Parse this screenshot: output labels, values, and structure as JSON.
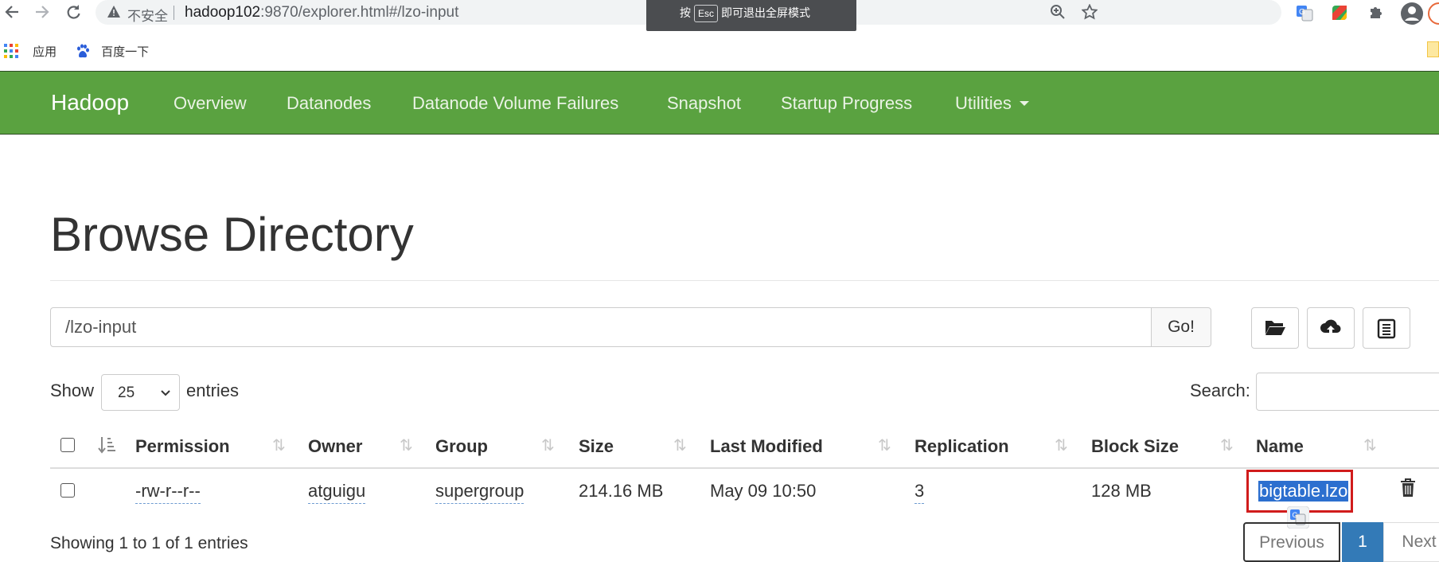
{
  "browser": {
    "insecure_label": "不安全",
    "url_host": "hadoop102",
    "url_rest": ":9870/explorer.html#/lzo-input",
    "fullscreen_hint": {
      "prefix": "按",
      "key": "Esc",
      "suffix": "即可退出全屏模式"
    },
    "bookmarks": [
      {
        "label": "应用",
        "icon": "apps-grid-icon"
      },
      {
        "label": "百度一下",
        "icon": "baidu-paw-icon"
      }
    ]
  },
  "navbar": {
    "brand": "Hadoop",
    "links": [
      "Overview",
      "Datanodes",
      "Datanode Volume Failures",
      "Snapshot",
      "Startup Progress",
      "Utilities"
    ]
  },
  "page": {
    "title": "Browse Directory",
    "path_value": "/lzo-input",
    "go_label": "Go!",
    "show_label": "Show",
    "page_length": "25",
    "entries_label": "entries",
    "search_label": "Search:",
    "search_value": ""
  },
  "table": {
    "columns": [
      "Permission",
      "Owner",
      "Group",
      "Size",
      "Last Modified",
      "Replication",
      "Block Size",
      "Name"
    ],
    "rows": [
      {
        "permission": "-rw-r--r--",
        "owner": "atguigu",
        "group": "supergroup",
        "size": "214.16 MB",
        "last_modified": "May 09 10:50",
        "replication": "3",
        "block_size": "128 MB",
        "name": "bigtable.lzo"
      }
    ]
  },
  "footer": {
    "info": "Showing 1 to 1 of 1 entries",
    "previous": "Previous",
    "page": "1",
    "next": "Next"
  },
  "colors": {
    "navbar": "#5aa240",
    "highlight_box": "#d11c1c",
    "selection": "#2c6fcf",
    "pager_active": "#337ab7"
  }
}
